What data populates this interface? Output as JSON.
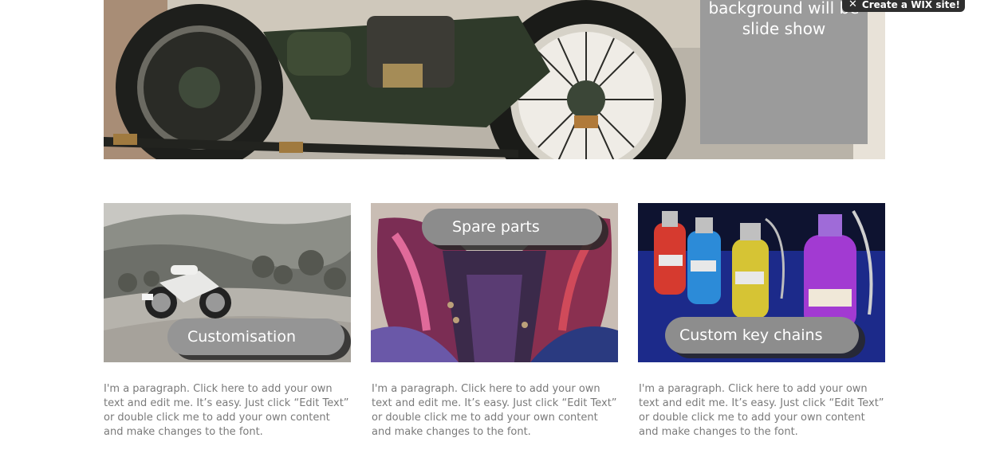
{
  "hero": {
    "box_line1": "background will be",
    "box_line2": "slide show"
  },
  "wix_banner": {
    "close_glyph": "✕",
    "label": "Create a WIX site!"
  },
  "cards": [
    {
      "title": "Customisation",
      "text": "I'm a paragraph. Click here to add your own text and edit me. It’s easy. Just click “Edit Text” or double click me to add your own content and make changes to the font."
    },
    {
      "title": "Spare parts",
      "text": "I'm a paragraph. Click here to add your own text and edit me. It’s easy. Just click “Edit Text” or double click me to add your own content and make changes to the font."
    },
    {
      "title": "Custom key chains",
      "text": "I'm a paragraph. Click here to add your own text and edit me. It’s easy. Just click “Edit Text” or double click me to add your own content and make changes to the font."
    }
  ]
}
